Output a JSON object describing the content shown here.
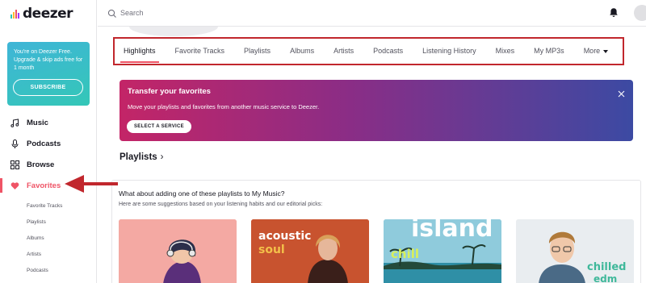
{
  "app": {
    "logo_text": "deezer"
  },
  "promo": {
    "text": "You're on Deezer Free. Upgrade & skip ads free for 1 month",
    "button": "SUBSCRIBE"
  },
  "sidebar": {
    "items": [
      {
        "label": "Music",
        "icon": "music-note-icon"
      },
      {
        "label": "Podcasts",
        "icon": "microphone-icon"
      },
      {
        "label": "Browse",
        "icon": "grid-icon"
      },
      {
        "label": "Favorites",
        "icon": "heart-icon",
        "active": true
      }
    ],
    "sub_items": [
      "Favorite Tracks",
      "Playlists",
      "Albums",
      "Artists",
      "Podcasts"
    ]
  },
  "search": {
    "placeholder": "Search"
  },
  "tabs": [
    {
      "label": "Highlights",
      "active": true
    },
    {
      "label": "Favorite Tracks"
    },
    {
      "label": "Playlists"
    },
    {
      "label": "Albums"
    },
    {
      "label": "Artists"
    },
    {
      "label": "Podcasts"
    },
    {
      "label": "Listening History"
    },
    {
      "label": "Mixes"
    },
    {
      "label": "My MP3s"
    },
    {
      "label": "More"
    }
  ],
  "banner": {
    "title": "Transfer your favorites",
    "text": "Move your playlists and favorites from another music service to Deezer.",
    "button": "SELECT A SERVICE"
  },
  "section": {
    "title": "Playlists",
    "chevron": "›"
  },
  "suggestions": {
    "title": "What about adding one of these playlists to My Music?",
    "subtitle": "Here are some suggestions based on your listening habits and our editorial picks:",
    "cards": [
      {
        "line1": "",
        "line2": ""
      },
      {
        "line1": "acoustic",
        "line2": "soul"
      },
      {
        "line1": "island",
        "line2": "chill"
      },
      {
        "line1": "chilled",
        "line2": "edm"
      }
    ]
  },
  "colors": {
    "accent": "#ef5466",
    "annotation": "#c1272d",
    "promo": "#3fb5d7"
  }
}
